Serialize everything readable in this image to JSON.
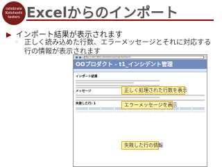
{
  "logo": {
    "line1": "celebrate",
    "line2": "Kotohoshi",
    "line3": "testers"
  },
  "title": "Excelからのインポート",
  "bullets": {
    "main": "インポート結果が表示されます",
    "sub": "正しく読み込めた行数、エラーメッセージとそれに対応する行の情報が表示されます"
  },
  "screenshot": {
    "app_title": "OOプロダクト - t1_インシデント管理",
    "address": "http://192.168.1.10/redmine/projects/import",
    "section_import": "インポート結果",
    "section_message": "メッセージ",
    "section_failed": "失敗した行: 1"
  },
  "callouts": {
    "success_rows": "正しく処理された行数を表示",
    "error_message": "エラーメッセージを表示",
    "failed_rows": "失敗した行の情報"
  },
  "colors": {
    "accent": "#a40000",
    "callout_bg": "#fff4ad",
    "app_header": "#6f8bbf"
  }
}
